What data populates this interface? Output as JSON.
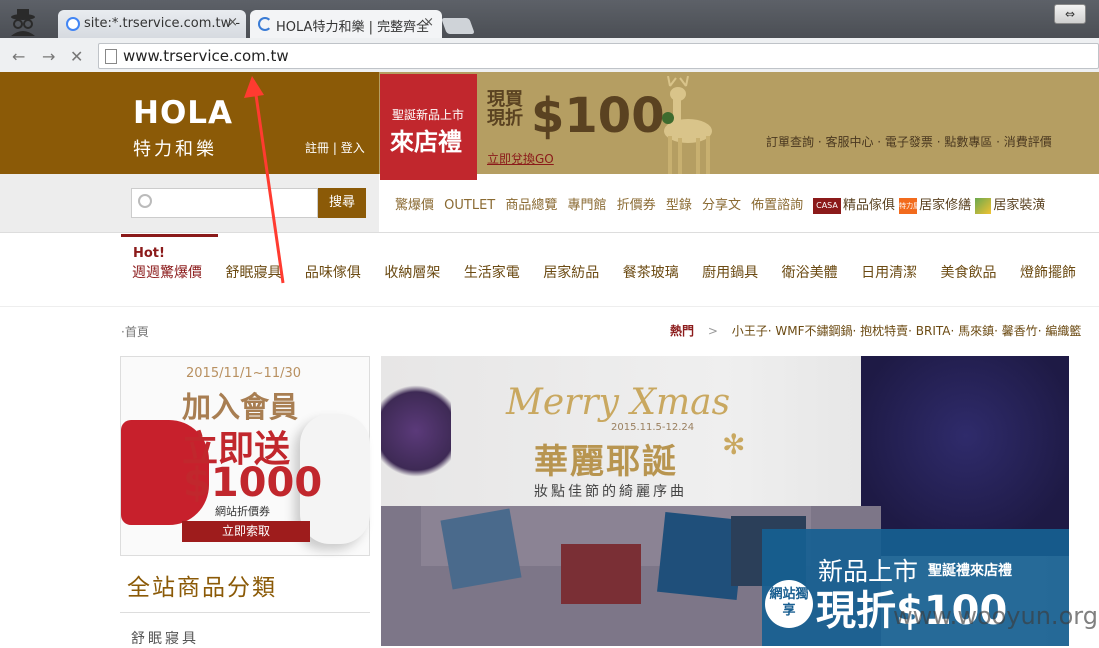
{
  "browser": {
    "tabs": [
      {
        "label": "site:*.trservice.com.tw -",
        "close": "×"
      },
      {
        "label": "HOLA特力和樂 | 完整齊全",
        "close": "×"
      }
    ],
    "window_btn": "⇔",
    "back": "←",
    "forward": "→",
    "stop": "✕",
    "url": "www.trservice.com.tw"
  },
  "header": {
    "logo": "HOLA",
    "logo_sub": "特力和樂",
    "register": "註冊",
    "sep": "|",
    "login": "登入",
    "ribbon_line1": "聖誕新品上市",
    "ribbon_line2": "來店禮",
    "promo_text": "現買現折",
    "promo_price": "$100",
    "promo_link": "立即兌換GO",
    "top_links": "訂單查詢 · 客服中心 · 電子發票 · 點數專區 · 消費評價"
  },
  "search": {
    "placeholder": "",
    "button": "搜尋"
  },
  "quick_links": [
    "驚爆價",
    "OUTLET",
    "商品總覽",
    "專門館",
    "折價券",
    "型錄",
    "分享文",
    "佈置諮詢"
  ],
  "brand_links": [
    {
      "icon": "CASA",
      "label": "精品傢俱",
      "color": "#8b1a1a"
    },
    {
      "icon": "特力屋",
      "label": "居家修繕",
      "color": "#f26b1d"
    },
    {
      "icon": "",
      "label": "居家裝潢",
      "color": "#6aa84f"
    }
  ],
  "nav": {
    "hot_label": "Hot!",
    "categories": [
      "週週驚爆價",
      "舒眠寢具",
      "品味傢俱",
      "收納層架",
      "生活家電",
      "居家紡品",
      "餐茶玻璃",
      "廚用鍋具",
      "衛浴美體",
      "日用清潔",
      "美食飲品",
      "燈飾擺飾"
    ]
  },
  "breadcrumb": "·首頁",
  "hot_tags": {
    "label": "熱門",
    "arrow": ">",
    "items": "小王子· WMF不鏽鋼鍋· 抱枕特賣· BRITA· 馬來鎮· 馨香竹· 編織籃"
  },
  "member_promo": {
    "date": "2015/11/1~11/30",
    "line1": "加入會員",
    "line2": "立即送",
    "line3": "$1000",
    "coupon": "網站折價券",
    "button": "立即索取"
  },
  "category_panel": {
    "title": "全站商品分類",
    "items": [
      "舒眠寢具"
    ]
  },
  "hero": {
    "merry": "Merry Xmas",
    "date": "2015.11.5-12.24",
    "title": "華麗耶誕",
    "subtitle": "妝點佳節的綺麗序曲",
    "offer_line1": "新品上市",
    "offer_line1b": "聖誕禮來店禮",
    "offer_badge": "網站獨享",
    "offer_line2": "現折$100"
  },
  "watermark": "www.wooyun.org",
  "colors": {
    "brand_brown": "#8b5a07",
    "banner_tan": "#b59e62",
    "ribbon_red": "#c1272d",
    "offer_blue": "#166091",
    "arrow_red": "#ff3b30"
  }
}
